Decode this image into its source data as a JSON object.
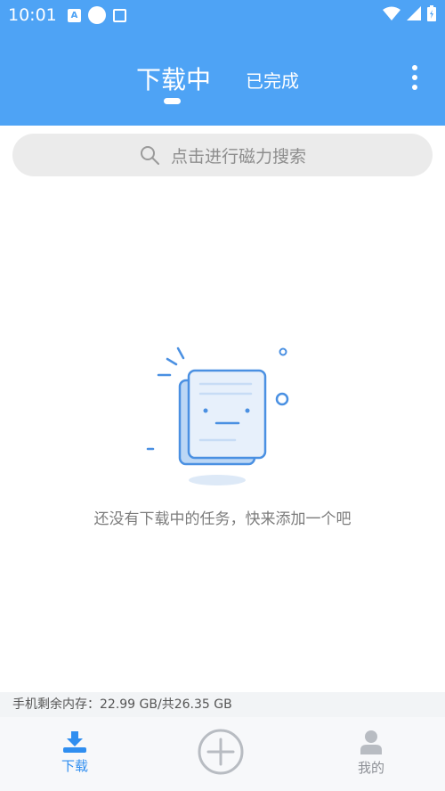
{
  "status_bar": {
    "time": "10:01",
    "app_icon_label": "A"
  },
  "header": {
    "tabs": [
      {
        "label": "下载中",
        "active": true
      },
      {
        "label": "已完成",
        "active": false
      }
    ],
    "more_icon": "more-vert-icon"
  },
  "search": {
    "placeholder": "点击进行磁力搜索",
    "icon": "search-icon"
  },
  "empty_state": {
    "message": "还没有下载中的任务，快来添加一个吧",
    "icon": "empty-document-icon"
  },
  "storage": {
    "text": "手机剩余内存：22.99 GB/共26.35 GB"
  },
  "bottom_nav": {
    "items": [
      {
        "label": "下载",
        "icon": "download-icon",
        "active": true
      },
      {
        "label": "",
        "icon": "add-circle-icon",
        "active": false
      },
      {
        "label": "我的",
        "icon": "person-icon",
        "active": false
      }
    ]
  },
  "colors": {
    "primary": "#4ea3f5",
    "active_nav": "#2f8ef0",
    "inactive_nav": "#b8bcc2"
  }
}
